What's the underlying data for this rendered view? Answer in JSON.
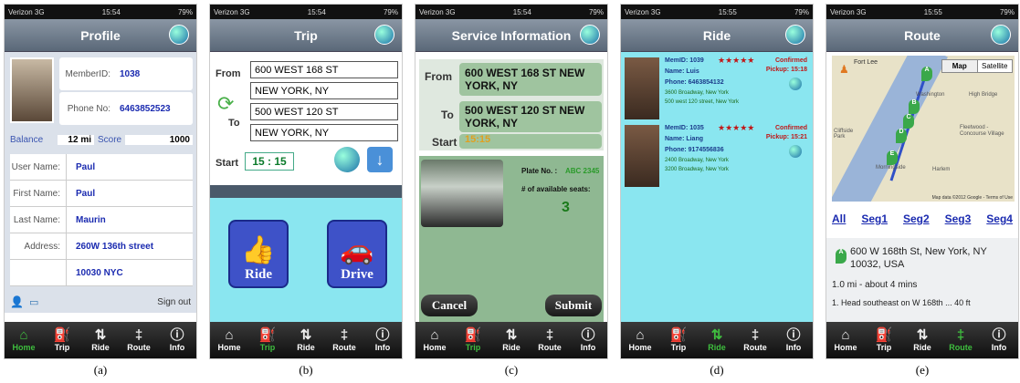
{
  "status_bar": {
    "carrier": "Verizon 3G",
    "battery": "79%",
    "times": [
      "15:54",
      "15:54",
      "15:54",
      "15:55",
      "15:55"
    ]
  },
  "tabs": {
    "home": "Home",
    "trip": "Trip",
    "ride": "Ride",
    "route": "Route",
    "info": "Info"
  },
  "captions": [
    "(a)",
    "(b)",
    "(c)",
    "(d)",
    "(e)"
  ],
  "profile": {
    "title": "Profile",
    "member_id_label": "MemberID:",
    "member_id": "1038",
    "phone_label": "Phone No:",
    "phone": "6463852523",
    "balance_label": "Balance",
    "balance": "12 mi",
    "score_label": "Score",
    "score": "1000",
    "fields": [
      {
        "label": "User Name:",
        "value": "Paul"
      },
      {
        "label": "First Name:",
        "value": "Paul"
      },
      {
        "label": "Last Name:",
        "value": "Maurin"
      },
      {
        "label": "Address:",
        "value": "260W 136th street"
      }
    ],
    "address2": "10030 NYC",
    "sign_out": "Sign out"
  },
  "trip": {
    "title": "Trip",
    "from_label": "From",
    "from_line1": "600 WEST 168 ST",
    "from_line2": "NEW YORK, NY",
    "to_label": "To",
    "to_line1": "500 WEST 120 ST",
    "to_line2": "NEW YORK, NY",
    "start_label": "Start",
    "start_time": "15 : 15",
    "ride_button": "Ride",
    "drive_button": "Drive"
  },
  "service": {
    "title": "Service Information",
    "from_label": "From",
    "from_value": "600 WEST 168 ST NEW YORK, NY",
    "to_label": "To",
    "to_value": "500 WEST 120 ST NEW YORK, NY",
    "start_label": "Start",
    "start_value": "15:15",
    "plate_label": "Plate No. :",
    "plate_value": "ABC 2345",
    "seats_label": "# of available seats:",
    "seats_value": "3",
    "cancel": "Cancel",
    "submit": "Submit"
  },
  "ride": {
    "title": "Ride",
    "offers": [
      {
        "mem": "MemID: 1039",
        "status": "Confirmed",
        "name": "Name: Luis",
        "pickup": "Pickup: 15:18",
        "phone": "Phone: 6463854132",
        "addr1": "3600 Broadway, New York",
        "addr2": "500 west 120 street, New York"
      },
      {
        "mem": "MemID: 1035",
        "status": "Confirmed",
        "name": "Name: Liang",
        "pickup": "Pickup: 15:21",
        "phone": "Phone: 9174556836",
        "addr1": "2400 Broadway, New York",
        "addr2": "3200 Broadway, New York"
      }
    ]
  },
  "route": {
    "title": "Route",
    "map_btn": "Map",
    "satellite_btn": "Satellite",
    "map_labels": [
      "Fort Lee",
      "Washington",
      "High Bridge",
      "Fleetwood - Concourse Village",
      "Cliffside Park",
      "Morningside",
      "Harlem"
    ],
    "map_credit": "Map data ©2012 Google - Terms of Use",
    "markers": [
      "A",
      "B",
      "C",
      "D",
      "E"
    ],
    "segments": [
      "All",
      "Seg1",
      "Seg2",
      "Seg3",
      "Seg4"
    ],
    "step_marker": "A",
    "address": "600 W 168th St, New York, NY 10032, USA",
    "distance": "1.0 mi - about 4 mins",
    "next_step": "1. Head southeast on W 168th ... 40 ft"
  }
}
